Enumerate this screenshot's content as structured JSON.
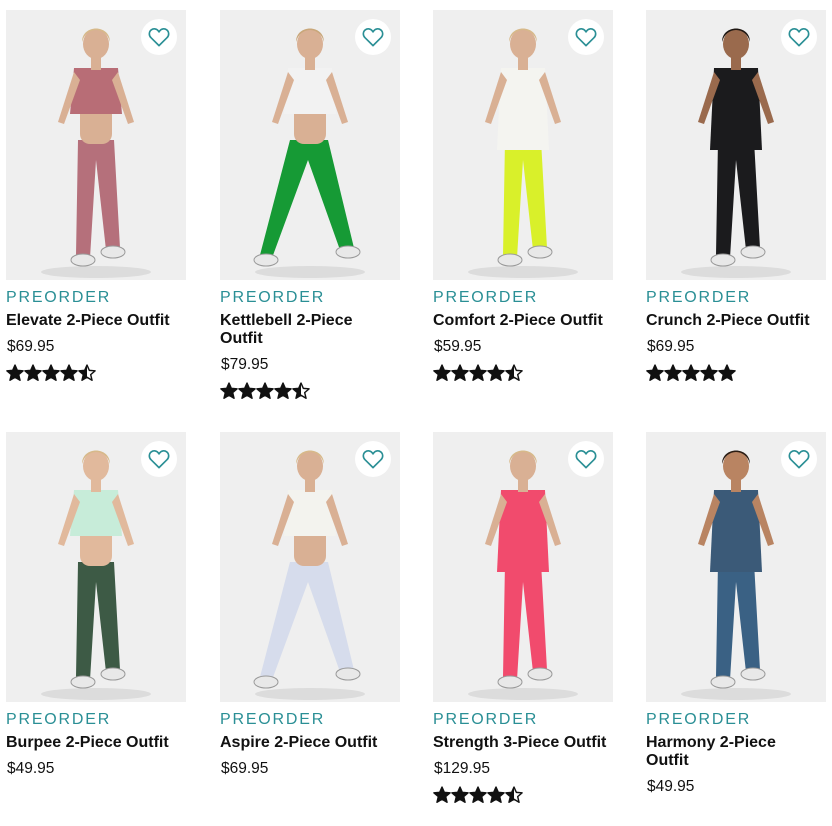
{
  "products": [
    {
      "badge": "PREORDER",
      "name": "Elevate 2-Piece Outfit",
      "price": "$69.95",
      "rating": 4.5,
      "colors": {
        "top": "#b86d76",
        "bottom": "#b5707b",
        "skin": "#d9b094",
        "hair": "#d7b98a",
        "bg": "#efefef"
      }
    },
    {
      "badge": "PREORDER",
      "name": "Kettlebell 2-Piece Outfit",
      "price": "$79.95",
      "rating": 4.5,
      "colors": {
        "top": "#f2f2f2",
        "bottom": "#169a35",
        "skin": "#d9b094",
        "hair": "#c9a77a",
        "bg": "#efefef"
      }
    },
    {
      "badge": "PREORDER",
      "name": "Comfort 2-Piece Outfit",
      "price": "$59.95",
      "rating": 4.5,
      "colors": {
        "top": "#f4f4f0",
        "bottom": "#d9f02a",
        "skin": "#d9b094",
        "hair": "#d7b98a",
        "bg": "#efefef"
      }
    },
    {
      "badge": "PREORDER",
      "name": "Crunch 2-Piece Outfit",
      "price": "$69.95",
      "rating": 5,
      "colors": {
        "top": "#1b1b1d",
        "bottom": "#1b1b1d",
        "skin": "#9a6a4d",
        "hair": "#1f1712",
        "bg": "#efefef"
      }
    },
    {
      "badge": "PREORDER",
      "name": "Burpee 2-Piece Outfit",
      "price": "$49.95",
      "rating": null,
      "colors": {
        "top": "#c7ecd9",
        "bottom": "#3d5a45",
        "skin": "#e1b99c",
        "hair": "#d7b98a",
        "bg": "#efefef"
      }
    },
    {
      "badge": "PREORDER",
      "name": "Aspire 2-Piece Outfit",
      "price": "$69.95",
      "rating": null,
      "colors": {
        "top": "#f3f3ee",
        "bottom": "#d6dcec",
        "skin": "#d9b094",
        "hair": "#d7b98a",
        "bg": "#efefef"
      }
    },
    {
      "badge": "PREORDER",
      "name": "Strength 3-Piece Outfit",
      "price": "$129.95",
      "rating": 4.5,
      "colors": {
        "top": "#f14b6d",
        "bottom": "#f14b6d",
        "skin": "#d9b094",
        "hair": "#d7b98a",
        "bg": "#efefef"
      }
    },
    {
      "badge": "PREORDER",
      "name": "Harmony 2-Piece Outfit",
      "price": "$49.95",
      "rating": null,
      "colors": {
        "top": "#3b5a78",
        "bottom": "#3a6184",
        "skin": "#b98462",
        "hair": "#2b1d14",
        "bg": "#efefef"
      }
    }
  ],
  "ui": {
    "accent": "#2a8f95",
    "fav_icon": "heart-outline-icon",
    "star_icon": "star-icon"
  }
}
